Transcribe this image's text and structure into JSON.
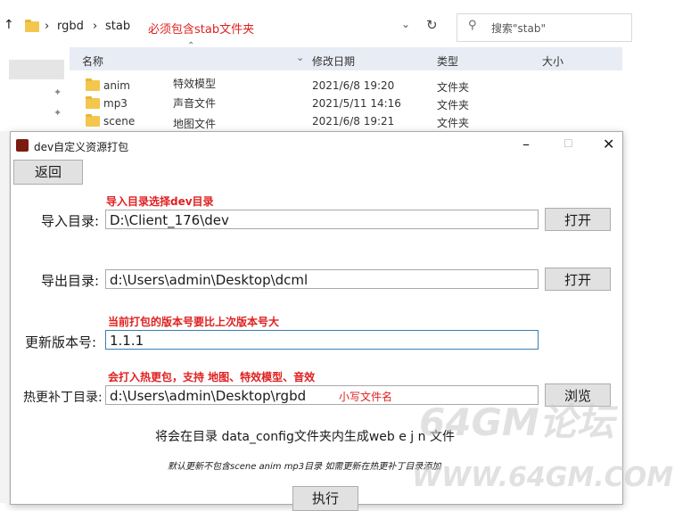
{
  "explorer": {
    "breadcrumb": [
      "rgbd",
      "stab"
    ],
    "path_note": "必须包含stab文件夹",
    "search_placeholder": "搜索\"stab\"",
    "columns": [
      "名称",
      "修改日期",
      "类型",
      "大小"
    ],
    "files": [
      {
        "name": "anim",
        "note": "特效模型",
        "date": "2021/6/8 19:20",
        "type": "文件夹"
      },
      {
        "name": "mp3",
        "note": "声音文件",
        "date": "2021/5/11 14:16",
        "type": "文件夹"
      },
      {
        "name": "scene",
        "note": "地图文件",
        "date": "2021/6/8 19:21",
        "type": "文件夹"
      }
    ]
  },
  "dialog": {
    "title": "dev自定义资源打包",
    "back_label": "返回",
    "import_note": "导入目录选择dev目录",
    "import_label": "导入目录:",
    "import_value": "D:\\Client_176\\dev",
    "open_label": "打开",
    "export_label": "导出目录:",
    "export_value": "d:\\Users\\admin\\Desktop\\dcml",
    "version_note": "当前打包的版本号要比上次版本号大",
    "version_label": "更新版本号:",
    "version_value": "1.1.1",
    "patch_note": "会打入热更包，支持 地图、特效模型、音效",
    "patch_label": "热更补丁目录:",
    "patch_value": "d:\\Users\\admin\\Desktop\\rgbd",
    "patch_hint": "小写文件名",
    "browse_label": "浏览",
    "info_text": "将会在目录 data_config文件夹内生成web e j  n 文件",
    "info_sub": "默认更新不包含scene anim mp3目录 如需更新在热更补丁目录添加",
    "execute_label": "执行"
  },
  "watermark": {
    "big": "64GM论坛",
    "url": "WWW.64GM.COM"
  }
}
